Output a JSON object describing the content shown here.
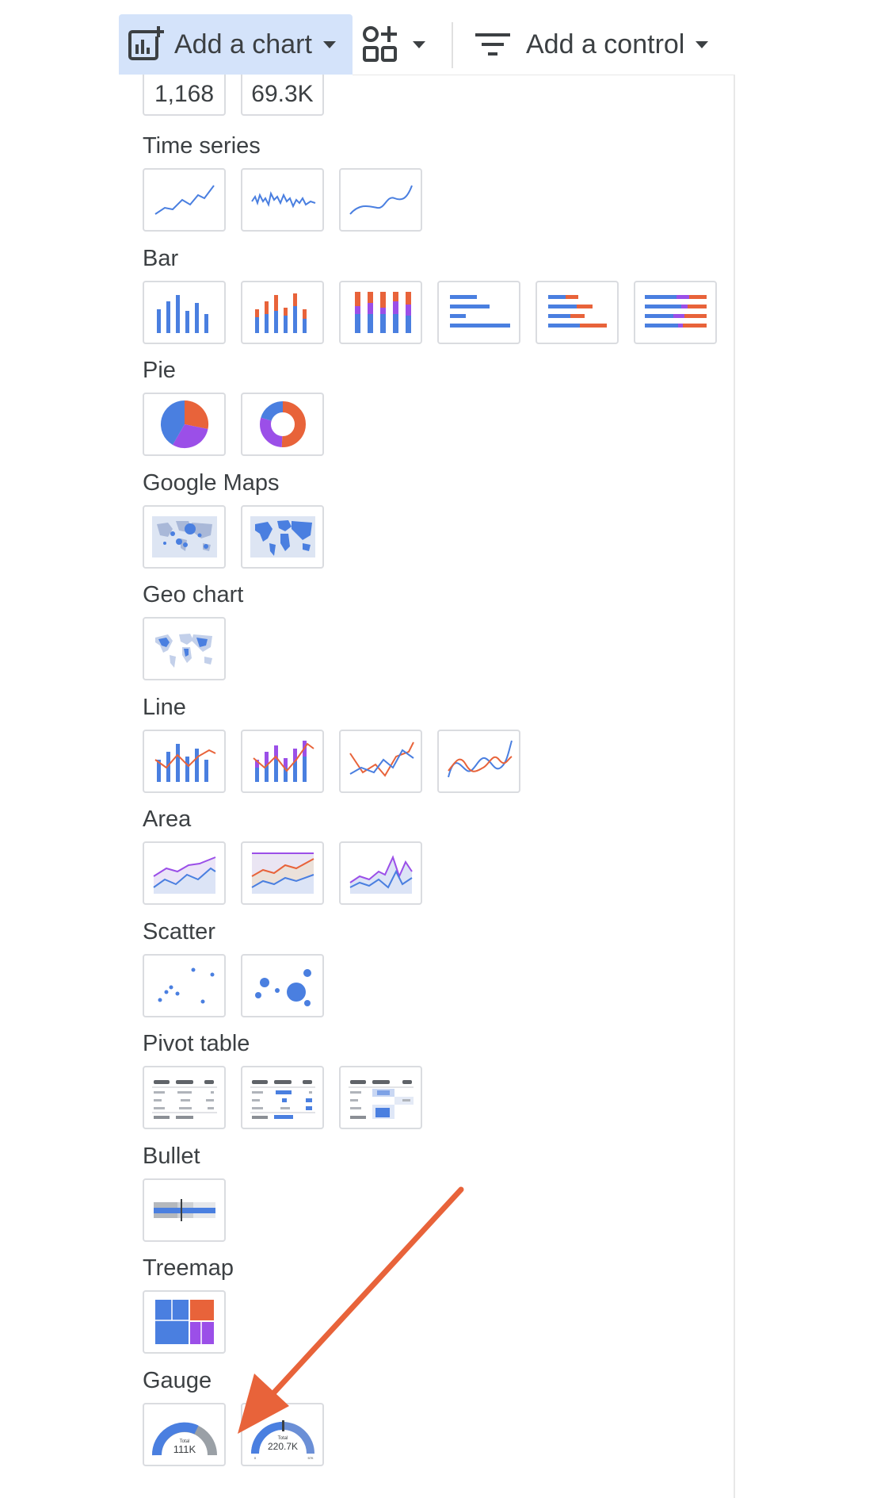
{
  "toolbar": {
    "add_chart_label": "Add a chart",
    "add_control_label": "Add a control",
    "icons": [
      "add-chart-icon",
      "components-icon",
      "filter-icon",
      "caret-down-icon"
    ]
  },
  "scorecard_values": [
    "1,168",
    "69.3K"
  ],
  "sections": {
    "time_series": "Time series",
    "bar": "Bar",
    "pie": "Pie",
    "google_maps": "Google Maps",
    "geo_chart": "Geo chart",
    "line": "Line",
    "area": "Area",
    "scatter": "Scatter",
    "pivot_table": "Pivot table",
    "bullet": "Bullet",
    "treemap": "Treemap",
    "gauge": "Gauge"
  },
  "gauge": {
    "first": {
      "caption": "Total",
      "value": "111K"
    },
    "second": {
      "caption": "Total",
      "value": "220.7K",
      "min": "0",
      "max": "57K"
    }
  },
  "colors": {
    "blue": "#4a7fe0",
    "orange": "#e8633a",
    "purple": "#9b4fe8",
    "toolbar_active": "#d4e3fa",
    "arrow": "#e8633a"
  }
}
